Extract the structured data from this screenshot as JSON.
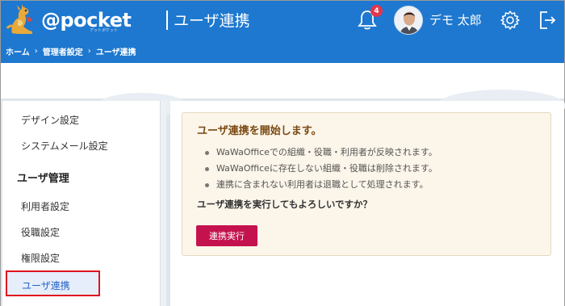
{
  "header": {
    "logo_text": "@pocket",
    "logo_sub": "アットポケット",
    "app_title": "ユーザ連携",
    "notification_count": "4",
    "user_name": "デモ 太郎",
    "brand_color": "#1e78cf"
  },
  "breadcrumb": {
    "items": [
      "ホーム",
      "管理者設定",
      "ユーザ連携"
    ],
    "separator": "›"
  },
  "sidebar": {
    "items": [
      {
        "label": "デザイン設定"
      },
      {
        "label": "システムメール設定"
      }
    ],
    "section_header": "ユーザ管理",
    "section_items": [
      {
        "label": "利用者設定"
      },
      {
        "label": "役職設定"
      },
      {
        "label": "権限設定"
      },
      {
        "label": "ユーザ連携",
        "active": true
      }
    ]
  },
  "notice": {
    "title": "ユーザ連携を開始します。",
    "bullets": [
      "WaWaOfficeでの組織・役職・利用者が反映されます。",
      "WaWaOfficeに存在しない組織・役職は削除されます。",
      "連携に含まれない利用者は退職として処理されます。"
    ],
    "question": "ユーザ連携を実行してもよろしいですか？",
    "button_label": "連携実行",
    "button_color": "#c4124f"
  }
}
